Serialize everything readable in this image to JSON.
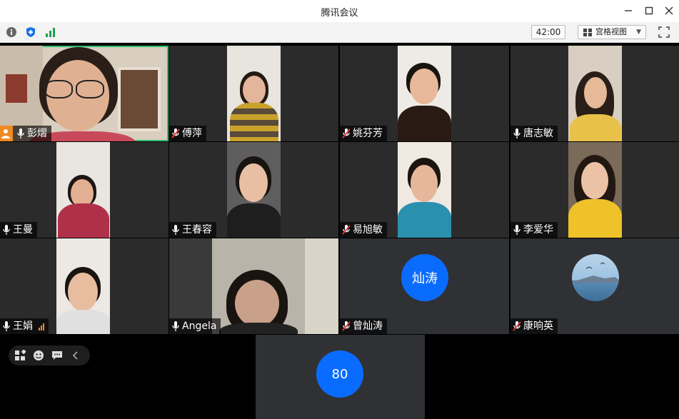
{
  "window": {
    "title": "腾讯会议"
  },
  "toolbar": {
    "timer": "42:00",
    "view_label": "宫格视图",
    "icons": [
      "info-icon",
      "shield-icon",
      "signal-bars-icon",
      "grid-icon",
      "fullscreen-icon"
    ]
  },
  "participants": [
    {
      "name": "彭熠",
      "mic": "on",
      "host": true,
      "active": true
    },
    {
      "name": "傅萍",
      "mic": "muted"
    },
    {
      "name": "姚芬芳",
      "mic": "muted"
    },
    {
      "name": "唐志敏",
      "mic": "on"
    },
    {
      "name": "王曼",
      "mic": "on"
    },
    {
      "name": "王春容",
      "mic": "on"
    },
    {
      "name": "易旭敏",
      "mic": "muted"
    },
    {
      "name": "李爱华",
      "mic": "on"
    },
    {
      "name": "王娟",
      "mic": "on",
      "speaking": true
    },
    {
      "name": "Angela",
      "mic": "on"
    },
    {
      "name": "曾灿涛",
      "mic": "muted",
      "avatar_text": "灿涛"
    },
    {
      "name": "康响英",
      "mic": "muted"
    }
  ],
  "extra_tile": {
    "avatar_text": "80"
  },
  "colors": {
    "accent": "#0a6cff",
    "active_border": "#2fbf71",
    "host": "#f08a24",
    "muted": "#e23b3b"
  }
}
